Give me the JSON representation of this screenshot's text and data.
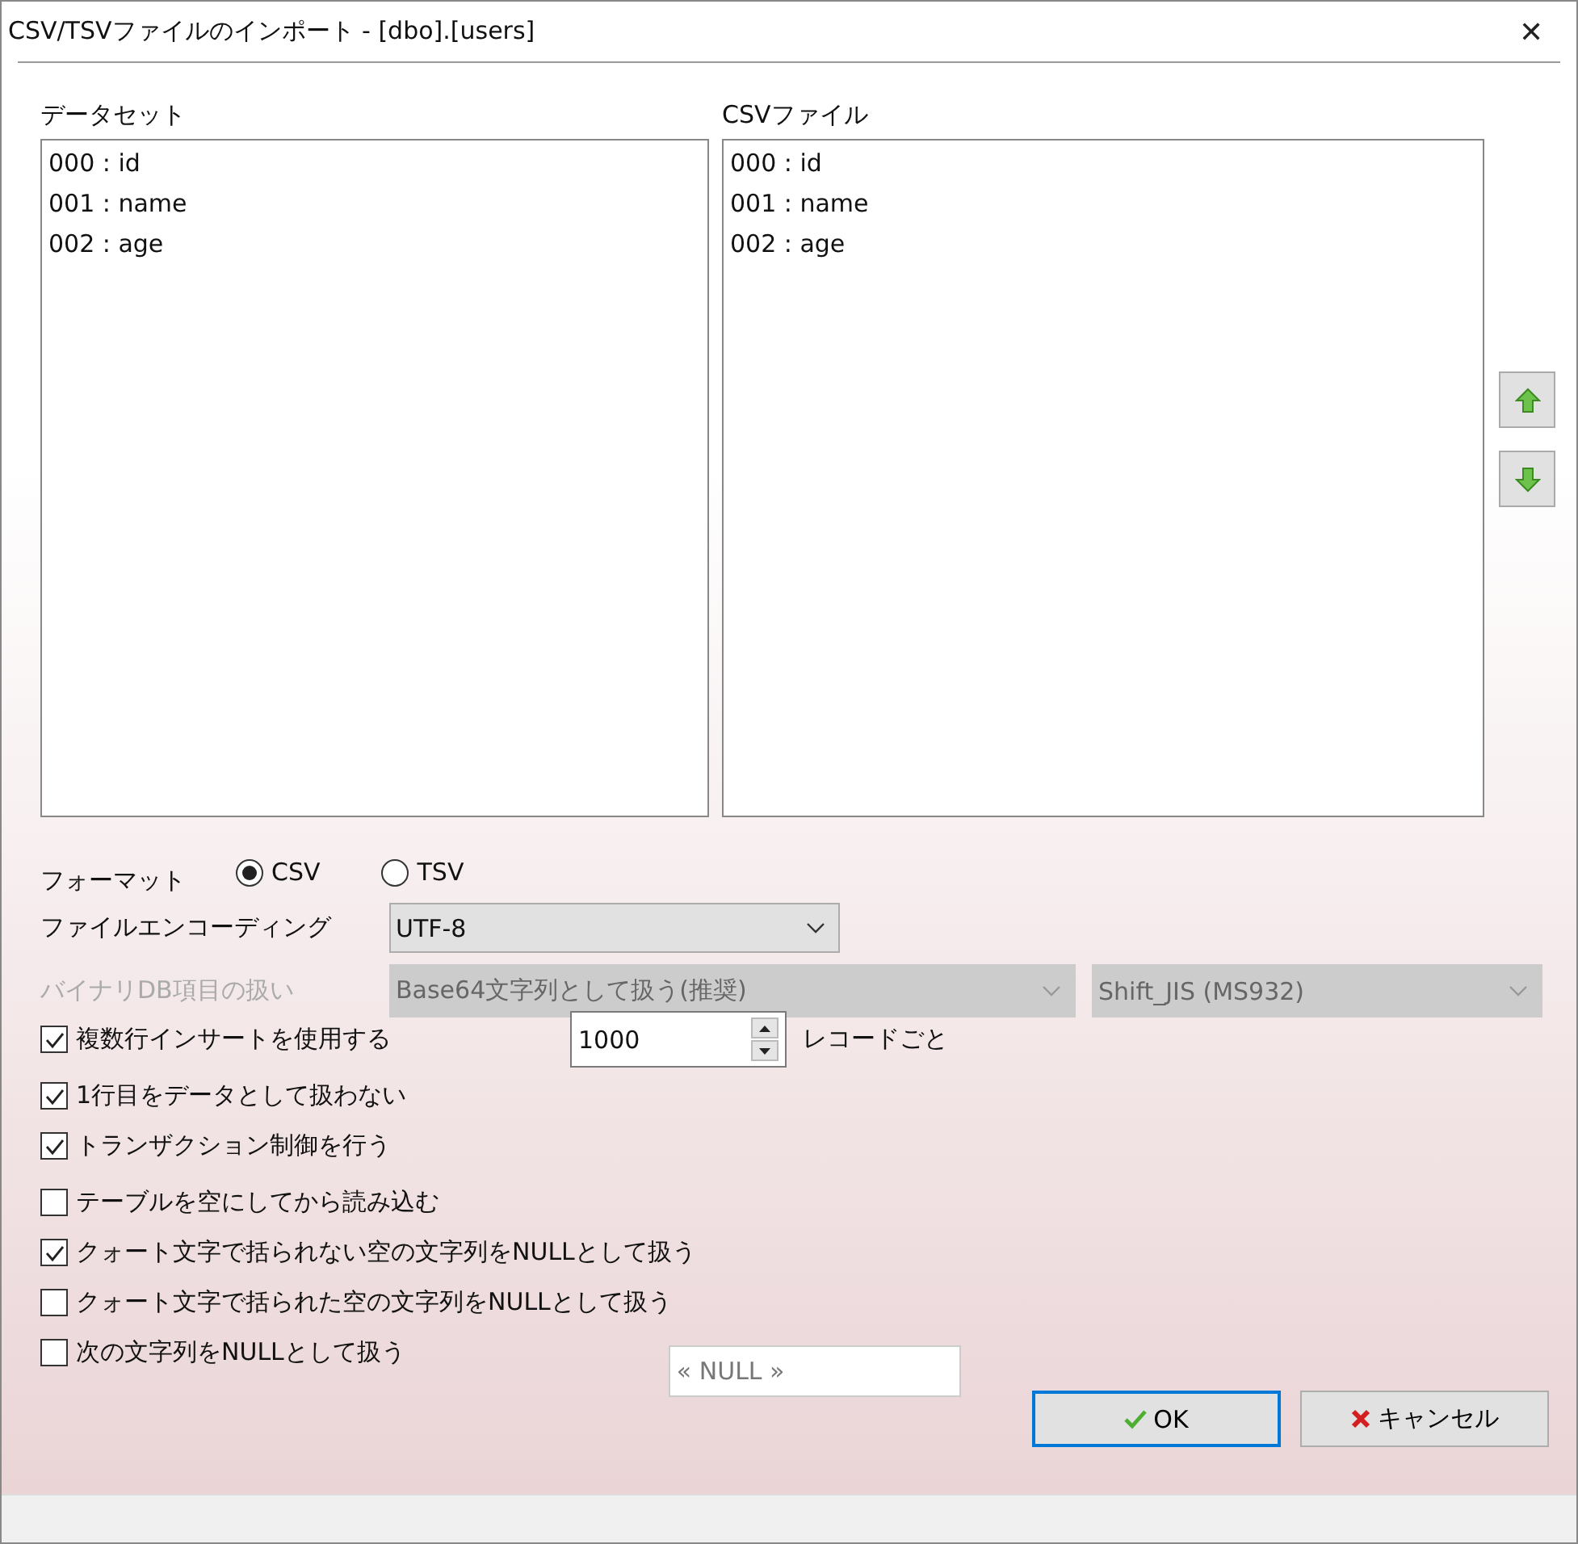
{
  "window": {
    "title": "CSV/TSVファイルのインポート - [dbo].[users]",
    "close": "✕"
  },
  "dataset": {
    "label": "データセット",
    "items": [
      "000 : id",
      "001 : name",
      "002 : age"
    ]
  },
  "csv_file": {
    "label": "CSVファイル",
    "items": [
      "000 : id",
      "001 : name",
      "002 : age"
    ]
  },
  "format": {
    "label": "フォーマット",
    "options": [
      {
        "label": "CSV",
        "selected": true
      },
      {
        "label": "TSV",
        "selected": false
      }
    ]
  },
  "encoding": {
    "label": "ファイルエンコーディング",
    "value": "UTF-8"
  },
  "binary": {
    "label": "バイナリDB項目の扱い",
    "disabled": true,
    "value": "Base64文字列として扱う(推奨)",
    "charset": "Shift_JIS (MS932)"
  },
  "options": [
    {
      "kind": "spinner",
      "label": "複数行インサートを使用する",
      "checked": true,
      "value": "1000",
      "suffix": "レコードごと"
    },
    {
      "kind": "plain",
      "label": "1行目をデータとして扱わない",
      "checked": true
    },
    {
      "kind": "plain",
      "label": "トランザクション制御を行う",
      "checked": true
    },
    {
      "kind": "plain",
      "label": "テーブルを空にしてから読み込む",
      "checked": false
    },
    {
      "kind": "plain",
      "label": "クォート文字で括られない空の文字列をNULLとして扱う",
      "checked": true
    },
    {
      "kind": "plain",
      "label": "クォート文字で括られた空の文字列をNULLとして扱う",
      "checked": false
    },
    {
      "kind": "field",
      "label": "次の文字列をNULLとして扱う",
      "checked": false,
      "placeholder": "« NULL »"
    }
  ],
  "buttons": [
    {
      "kind": "ok",
      "label": "OK"
    },
    {
      "kind": "cancel",
      "label": "キャンセル"
    }
  ]
}
